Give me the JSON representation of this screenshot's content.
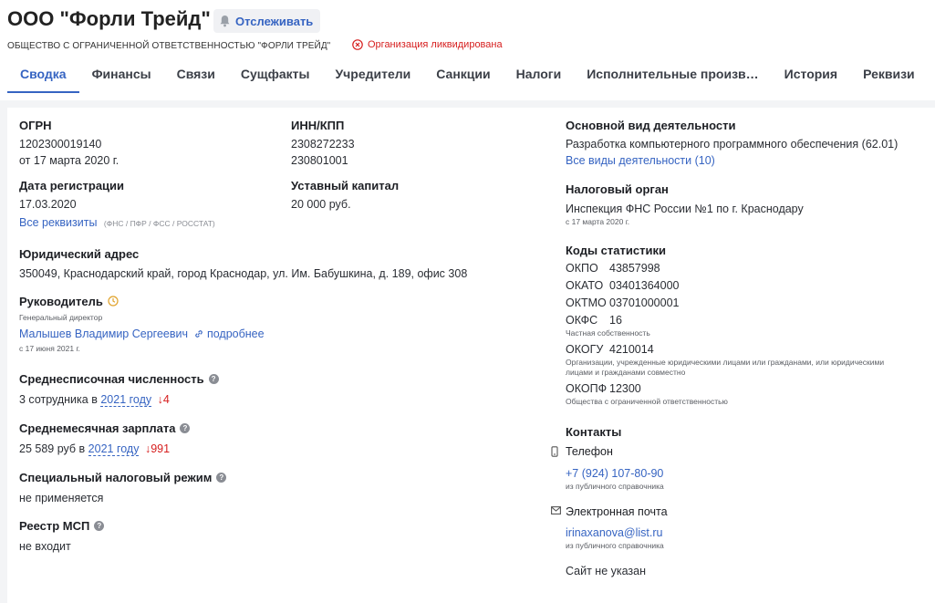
{
  "header": {
    "title": "ООО \"Форли Трейд\"",
    "track_label": "Отслеживать",
    "full_name": "ОБЩЕСТВО С ОГРАНИЧЕННОЙ ОТВЕТСТВЕННОСТЬЮ \"ФОРЛИ ТРЕЙД\"",
    "status": "Организация ликвидирована"
  },
  "tabs": [
    "Сводка",
    "Финансы",
    "Связи",
    "Сущфакты",
    "Учредители",
    "Санкции",
    "Налоги",
    "Исполнительные произв…",
    "История",
    "Реквизиты"
  ],
  "ogrn": {
    "label": "ОГРН",
    "value": "1202300019140",
    "date": "от 17 марта 2020 г."
  },
  "inn": {
    "label": "ИНН/КПП",
    "inn": "2308272233",
    "kpp": "230801001"
  },
  "registration": {
    "label": "Дата регистрации",
    "value": "17.03.2020",
    "link": "Все реквизиты",
    "sources": "(ФНС / ПФР / ФСС / РОССТАТ)"
  },
  "capital": {
    "label": "Уставный капитал",
    "value": "20 000 руб."
  },
  "address": {
    "label": "Юридический адрес",
    "value": "350049, Краснодарский край, город Краснодар, ул. Им. Бабушкина, д. 189, офис 308"
  },
  "director": {
    "label": "Руководитель",
    "position": "Генеральный директор",
    "name": "Малышев Владимир Сергеевич",
    "more": "подробнее",
    "since": "с 17 июня 2021 г."
  },
  "employees": {
    "label": "Среднесписочная численность",
    "text": "3 сотрудника в",
    "year": "2021 году",
    "change": "↓4"
  },
  "salary": {
    "label": "Среднемесячная зарплата",
    "text": "25 589 руб в",
    "year": "2021 году",
    "change": "↓991"
  },
  "tax_regime": {
    "label": "Специальный налоговый режим",
    "value": "не применяется"
  },
  "msp": {
    "label": "Реестр МСП",
    "value": "не входит"
  },
  "activity": {
    "label": "Основной вид деятельности",
    "value": "Разработка компьютерного программного обеспечения",
    "code": "(62.01)",
    "link": "Все виды деятельности (10)"
  },
  "tax_authority": {
    "label": "Налоговый орган",
    "value": "Инспекция ФНС России №1 по г. Краснодару",
    "since": "с 17 марта 2020 г."
  },
  "stat_codes": {
    "label": "Коды статистики",
    "okpo_k": "ОКПО",
    "okpo_v": "43857998",
    "okato_k": "ОКАТО",
    "okato_v": "03401364000",
    "oktmo_k": "ОКТМО",
    "oktmo_v": "03701000001",
    "okfs_k": "ОКФС",
    "okfs_v": "16",
    "okfs_note": "Частная собственность",
    "okogu_k": "ОКОГУ",
    "okogu_v": "4210014",
    "okogu_note": "Организации, учрежденные юридическими лицами или гражданами, или юридическими лицами и гражданами совместно",
    "okopf_k": "ОКОПФ",
    "okopf_v": "12300",
    "okopf_note": "Общества с ограниченной ответственностью"
  },
  "contacts": {
    "label": "Контакты",
    "phone_label": "Телефон",
    "phone": "+7 (924) 107-80-90",
    "phone_src": "из публичного справочника",
    "email_label": "Электронная почта",
    "email": "irinaxanova@list.ru",
    "email_src": "из публичного справочника",
    "site": "Сайт не указан"
  },
  "colors": {
    "accent": "#3664c2",
    "danger": "#d61e1e",
    "page_bg": "#f3f4f6"
  }
}
